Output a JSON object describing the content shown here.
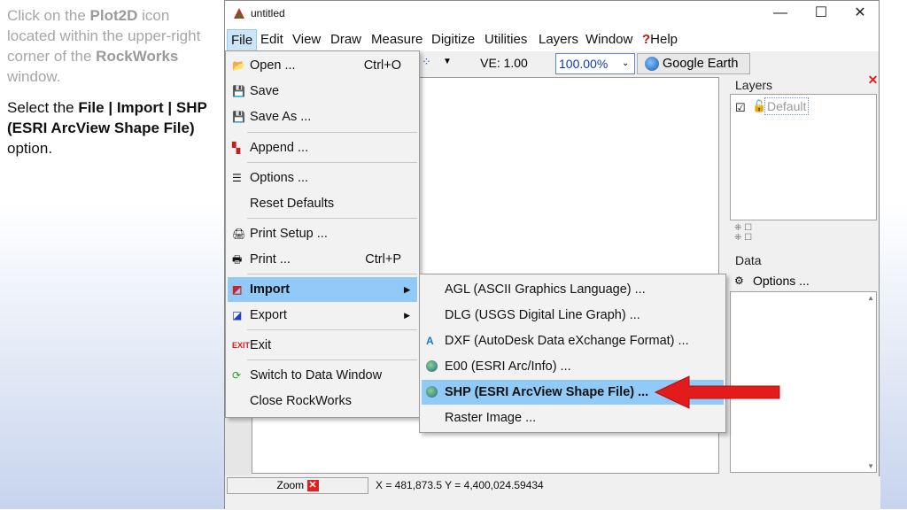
{
  "instructions": {
    "p1_pre": "Click on the ",
    "p1_b1": "Plot2D",
    "p1_mid": " icon located within the upper-right corner of the ",
    "p1_b2": "RockWorks",
    "p1_post": " window.",
    "p2_pre": "Select the ",
    "p2_b": "File | Import | SHP (ESRI ArcView Shape File)",
    "p2_post": " option."
  },
  "window": {
    "title": "untitled",
    "min": "—",
    "max": "☐",
    "close": "✕"
  },
  "menubar": [
    "File",
    "Edit",
    "View",
    "Draw",
    "Measure",
    "Digitize",
    "Utilities",
    "Layers",
    "Window",
    "Help"
  ],
  "toolbar": {
    "ve": "VE: 1.00",
    "zoom": "100.00%",
    "google_earth": "Google Earth"
  },
  "file_menu": [
    {
      "label": "Open ...",
      "shortcut": "Ctrl+O",
      "icon": "folder-icon"
    },
    {
      "label": "Save",
      "shortcut": "",
      "icon": "disk-icon"
    },
    {
      "label": "Save As ...",
      "shortcut": "",
      "icon": "disk-icon"
    },
    {
      "label": "Append ...",
      "shortcut": "",
      "icon": "append-icon"
    },
    {
      "label": "Options ...",
      "shortcut": "",
      "icon": "options-icon"
    },
    {
      "label": "Reset Defaults",
      "shortcut": "",
      "icon": ""
    },
    {
      "label": "Print Setup ...",
      "shortcut": "",
      "icon": "printer-setup-icon"
    },
    {
      "label": "Print ...",
      "shortcut": "Ctrl+P",
      "icon": "printer-icon"
    },
    {
      "label": "Import",
      "shortcut": "",
      "icon": "import-icon"
    },
    {
      "label": "Export",
      "shortcut": "",
      "icon": "export-icon"
    },
    {
      "label": "Exit",
      "shortcut": "",
      "icon": "exit-icon"
    },
    {
      "label": "Switch to Data Window",
      "shortcut": "",
      "icon": "switch-icon"
    },
    {
      "label": "Close RockWorks",
      "shortcut": "",
      "icon": ""
    }
  ],
  "import_submenu": [
    "AGL (ASCII Graphics Language) ...",
    "DLG (USGS Digital Line Graph) ...",
    "DXF (AutoDesk Data eXchange Format) ...",
    "E00 (ESRI Arc/Info) ...",
    "SHP (ESRI ArcView Shape File) ...",
    "Raster Image ..."
  ],
  "layers_panel": {
    "title": "Layers",
    "layer": "Default"
  },
  "data_panel": {
    "title": "Data",
    "options": "Options ..."
  },
  "status": {
    "zoom": "Zoom",
    "coords": "X = 481,873.5  Y = 4,400,024.59434"
  },
  "colors": {
    "highlight": "#91c9f7",
    "arrow": "#e31b1b"
  }
}
